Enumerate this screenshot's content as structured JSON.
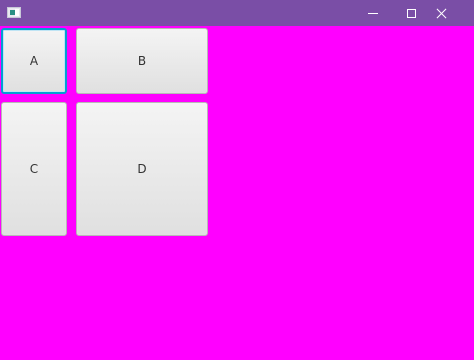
{
  "window": {
    "background": "#ff00ff",
    "titlebar_color": "#7a4ea6",
    "icon": "app-window-icon",
    "controls": [
      "minimize-icon",
      "maximize-icon",
      "close-icon"
    ]
  },
  "grid": {
    "buttons": [
      {
        "id": "a",
        "label": "A",
        "focused": true
      },
      {
        "id": "b",
        "label": "B",
        "focused": false
      },
      {
        "id": "c",
        "label": "C",
        "focused": false
      },
      {
        "id": "d",
        "label": "D",
        "focused": false
      }
    ],
    "focus_color": "#039ed3"
  }
}
